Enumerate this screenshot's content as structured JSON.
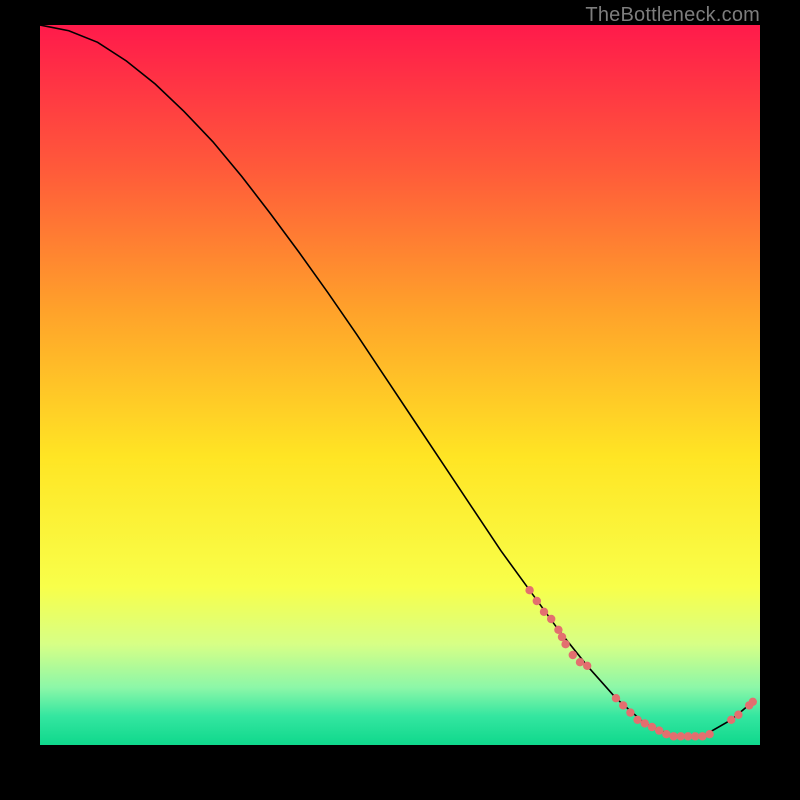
{
  "watermark": "TheBottleneck.com",
  "chart_data": {
    "type": "line",
    "title": "",
    "xlabel": "",
    "ylabel": "",
    "xlim": [
      0,
      100
    ],
    "ylim": [
      0,
      100
    ],
    "grid": false,
    "legend": false,
    "background_gradient": {
      "stops": [
        {
          "offset": 0.0,
          "color": "#ff1a4b"
        },
        {
          "offset": 0.2,
          "color": "#ff5a3a"
        },
        {
          "offset": 0.4,
          "color": "#ffa32a"
        },
        {
          "offset": 0.6,
          "color": "#ffe524"
        },
        {
          "offset": 0.78,
          "color": "#f8ff4a"
        },
        {
          "offset": 0.86,
          "color": "#d7ff86"
        },
        {
          "offset": 0.92,
          "color": "#8cf7a8"
        },
        {
          "offset": 0.96,
          "color": "#34e6a0"
        },
        {
          "offset": 1.0,
          "color": "#0fd88c"
        }
      ]
    },
    "series": [
      {
        "name": "bottleneck-curve",
        "color": "#000000",
        "width": 1.6,
        "x": [
          0,
          4,
          8,
          12,
          16,
          20,
          24,
          28,
          32,
          36,
          40,
          44,
          48,
          52,
          56,
          60,
          64,
          68,
          72,
          76,
          80,
          84,
          88,
          92,
          96,
          99
        ],
        "y": [
          100,
          99.2,
          97.6,
          95.0,
          91.8,
          88.0,
          83.8,
          79.0,
          73.8,
          68.4,
          62.8,
          57.0,
          51.0,
          45.0,
          39.0,
          33.0,
          27.0,
          21.5,
          16.0,
          11.0,
          6.5,
          3.0,
          1.2,
          1.2,
          3.5,
          6.0
        ]
      }
    ],
    "scatter": [
      {
        "name": "curve-markers",
        "color": "#e36f6f",
        "radius": 4.2,
        "points": [
          [
            68,
            21.5
          ],
          [
            69,
            20.0
          ],
          [
            70,
            18.5
          ],
          [
            71,
            17.5
          ],
          [
            72,
            16.0
          ],
          [
            72.5,
            15.0
          ],
          [
            73,
            14.0
          ],
          [
            74,
            12.5
          ],
          [
            75,
            11.5
          ],
          [
            76,
            11.0
          ],
          [
            80,
            6.5
          ],
          [
            81,
            5.5
          ],
          [
            82,
            4.5
          ],
          [
            83,
            3.5
          ],
          [
            84,
            3.0
          ],
          [
            85,
            2.5
          ],
          [
            86,
            2.0
          ],
          [
            87,
            1.5
          ],
          [
            88,
            1.2
          ],
          [
            89,
            1.2
          ],
          [
            90,
            1.2
          ],
          [
            91,
            1.2
          ],
          [
            92,
            1.2
          ],
          [
            93,
            1.5
          ],
          [
            96,
            3.5
          ],
          [
            97,
            4.2
          ],
          [
            98.5,
            5.5
          ],
          [
            99,
            6.0
          ]
        ]
      }
    ]
  }
}
